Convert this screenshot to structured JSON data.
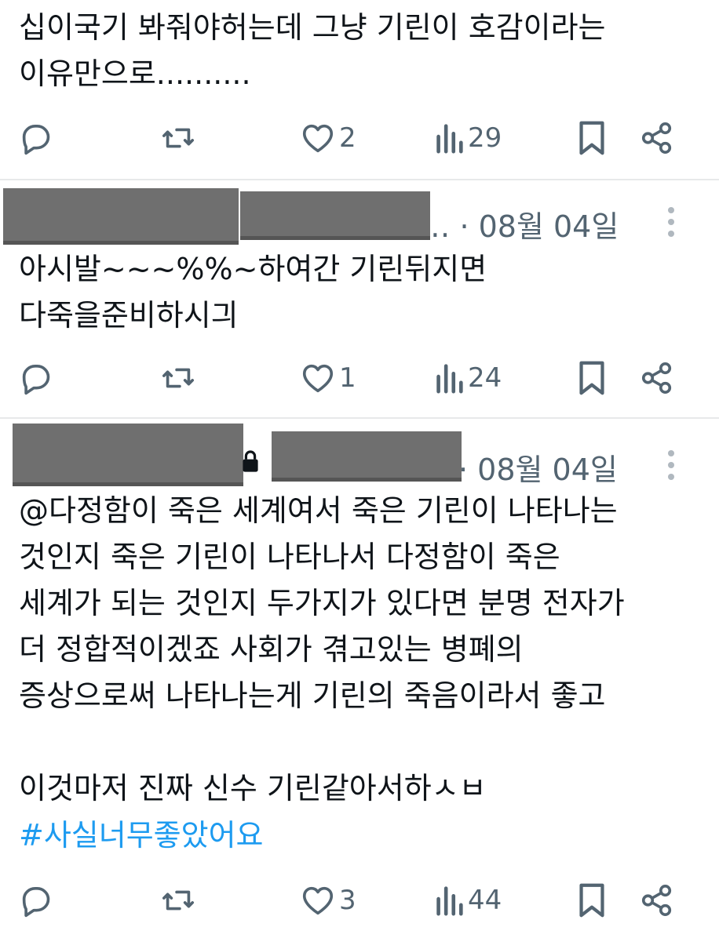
{
  "posts": [
    {
      "text": "십이국기 봐줘야허는데 그냥 기린이 호감이라는\n이유만으로..........",
      "actions": {
        "reply": "",
        "repost": "",
        "likes": "2",
        "views": "29"
      }
    },
    {
      "meta": "‥ · 08월 04일",
      "text": "아시발~~~%%~하여간 기린뒤지면\n다죽을준비하시긔",
      "actions": {
        "reply": "",
        "repost": "",
        "likes": "1",
        "views": "24"
      }
    },
    {
      "meta": "· 08월 04일",
      "text": "@다정함이 죽은 세계여서 죽은 기린이 나타나는\n것인지 죽은 기린이 나타나서 다정함이 죽은\n세계가 되는 것인지 두가지가 있다면 분명 전자가\n더 정합적이겠죠 사회가 겪고있는 병폐의\n증상으로써 나타나는게 기린의 죽음이라서 좋고\n\n이것마저 진짜 신수 기린같아서하ㅅㅂ",
      "hashtag": "#사실너무좋았어요",
      "actions": {
        "reply": "",
        "repost": "",
        "likes": "3",
        "views": "44"
      }
    }
  ],
  "icons": [
    "reply-icon",
    "repost-icon",
    "like-icon",
    "views-icon",
    "bookmark-icon",
    "share-icon",
    "more-icon",
    "lock-icon"
  ],
  "colors": {
    "text": "#0f1419",
    "muted": "#536471",
    "hashtag": "#1d9bf0",
    "divider": "#e7e9ea"
  }
}
